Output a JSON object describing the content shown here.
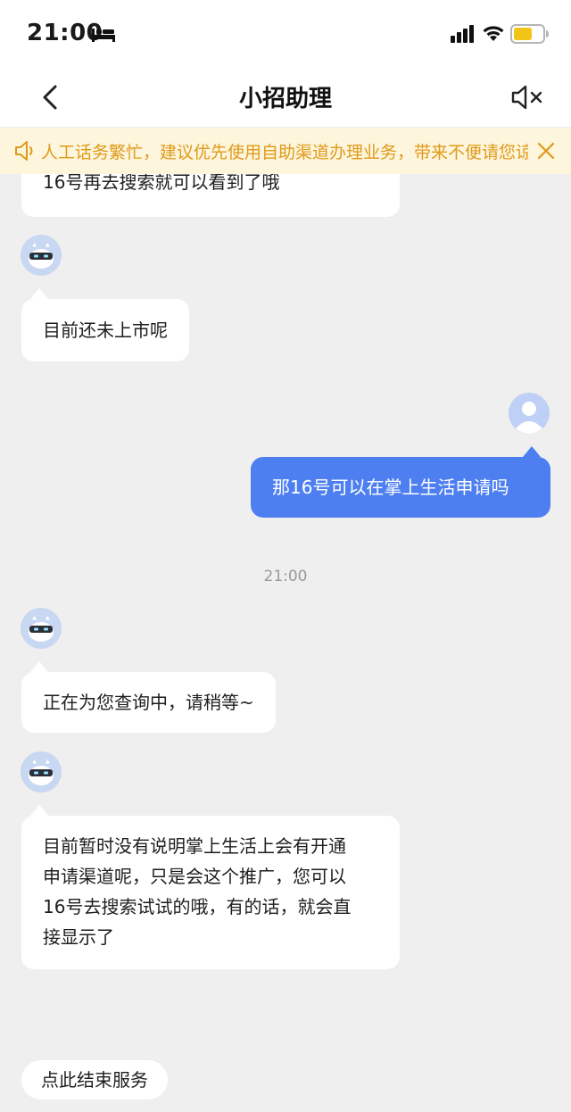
{
  "status_bar": {
    "time": "21:00"
  },
  "nav": {
    "title": "小招助理"
  },
  "notice": {
    "text": "人工话务繁忙，建议优先使用自助渠道办理业务，带来不便请您谅解"
  },
  "messages": [
    {
      "sender": "bot",
      "text": "16号再去搜索就可以看到了哦"
    },
    {
      "sender": "bot",
      "text": "目前还未上市呢"
    },
    {
      "sender": "user",
      "text": "那16号可以在掌上生活申请吗"
    },
    {
      "sender": "bot",
      "text": "正在为您查询中，请稍等~"
    },
    {
      "sender": "bot",
      "lines": [
        "目前暂时没有说明掌上生活上会有开通",
        "申请渠道呢，只是会这个推广，您可以",
        "16号去搜索试试的哦，有的话，就会直",
        "接显示了"
      ]
    }
  ],
  "timestamp": "21:00",
  "end_service_label": "点此结束服务",
  "colors": {
    "user_bubble": "#4d7ff0",
    "notice_bg": "#fdf5dc",
    "notice_text": "#e09a1a",
    "chat_bg": "#efefef"
  }
}
